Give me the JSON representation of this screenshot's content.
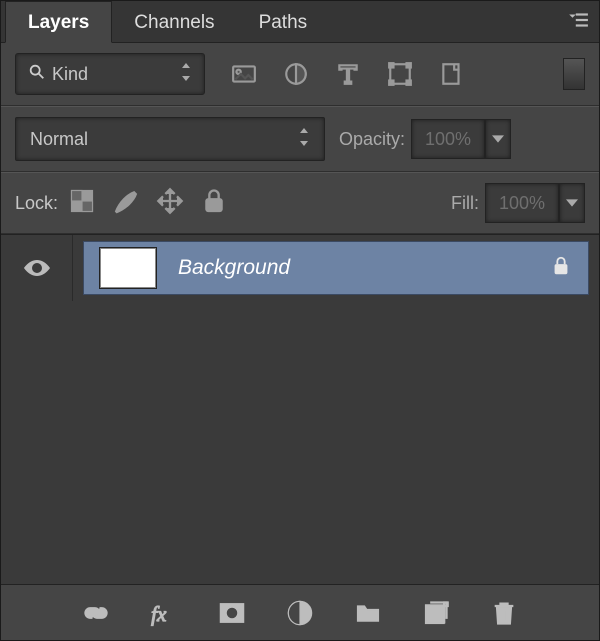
{
  "tabs": {
    "layers": "Layers",
    "channels": "Channels",
    "paths": "Paths"
  },
  "filter": {
    "kind": "Kind"
  },
  "blend": {
    "mode": "Normal"
  },
  "opacity": {
    "label": "Opacity:",
    "value": "100%"
  },
  "lock": {
    "label": "Lock:"
  },
  "fill": {
    "label": "Fill:",
    "value": "100%"
  },
  "layers": [
    {
      "name": "Background",
      "locked": true,
      "visible": true
    }
  ]
}
